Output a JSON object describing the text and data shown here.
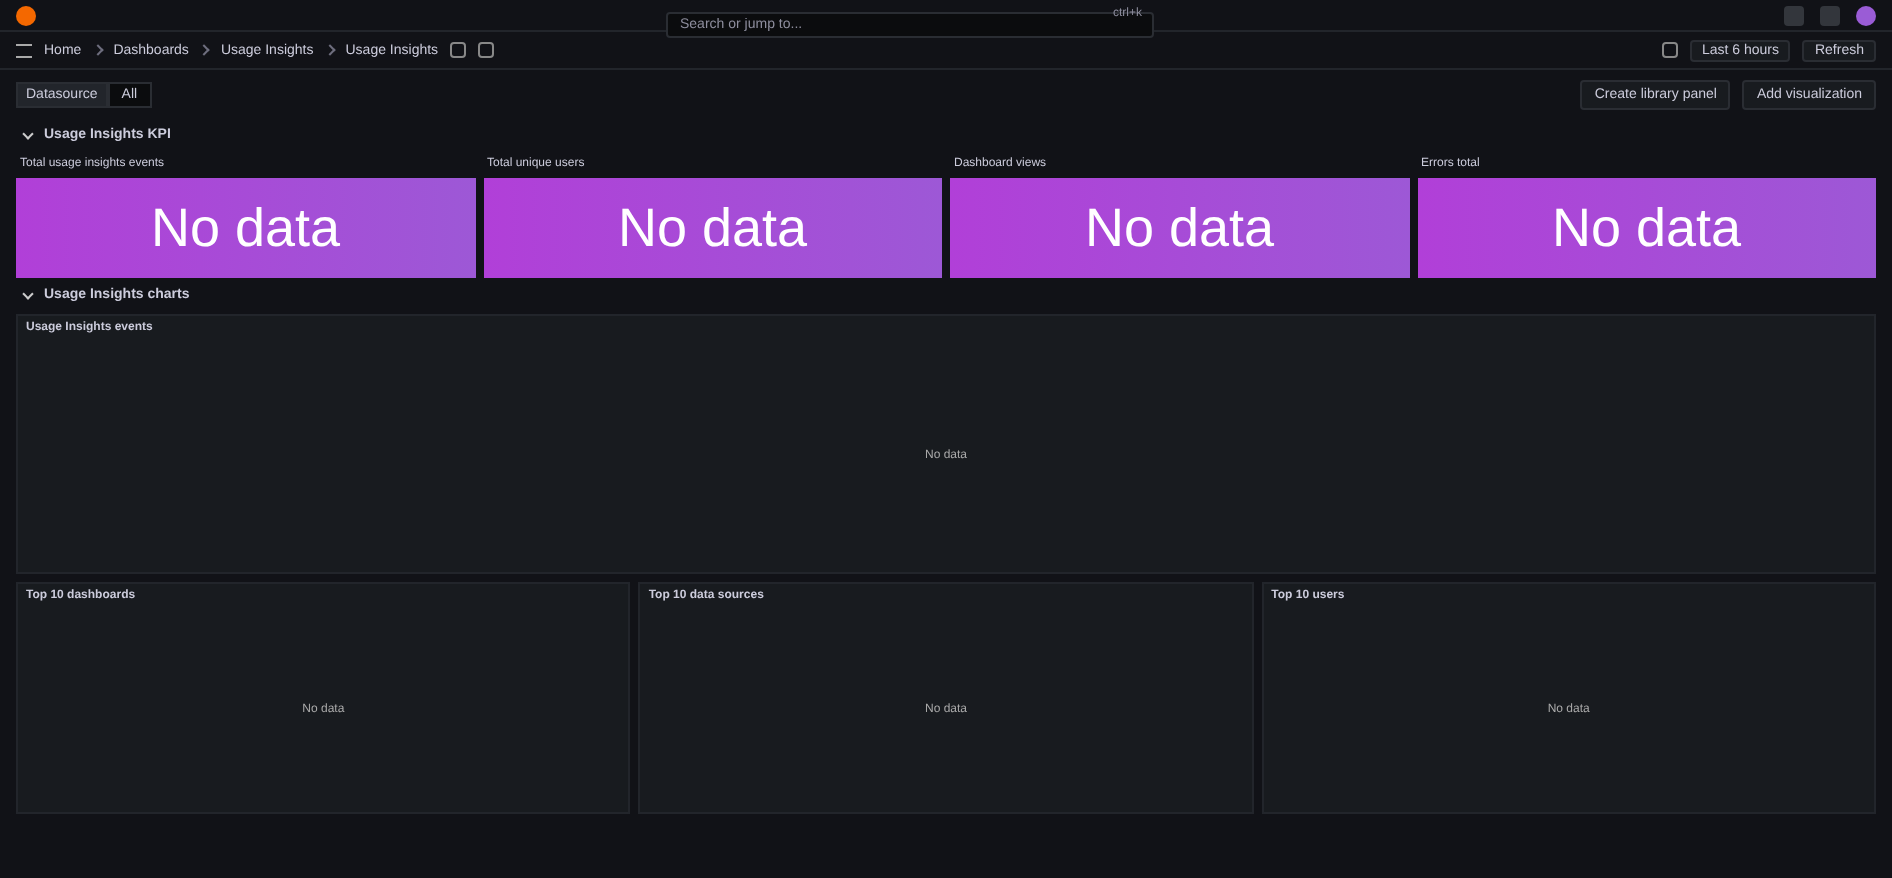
{
  "top_bar": {
    "search": {
      "placeholder": "Search or jump to..."
    },
    "shortcut": "ctrl+k"
  },
  "breadcrumbs": [
    {
      "label": "Home"
    },
    {
      "label": "Dashboards"
    },
    {
      "label": "Usage Insights"
    },
    {
      "label": "Usage Insights"
    }
  ],
  "toolbar": {
    "time_range": "Last 6 hours",
    "refresh": "Refresh"
  },
  "variables": [
    {
      "label": "Datasource",
      "value": "All"
    }
  ],
  "actions": [
    {
      "label": "Create library panel"
    },
    {
      "label": "Add visualization"
    }
  ],
  "rows": [
    {
      "title": "Usage Insights KPI",
      "expanded": true
    },
    {
      "title": "Usage Insights charts",
      "expanded": true
    }
  ],
  "stat_panels": [
    {
      "title": "Total usage insights events",
      "value": "No data"
    },
    {
      "title": "Total unique users",
      "value": "No data"
    },
    {
      "title": "Dashboard views",
      "value": "No data"
    },
    {
      "title": "Errors total",
      "value": "No data"
    }
  ],
  "main_panel": {
    "title": "Usage Insights events",
    "message": "No data"
  },
  "panels": [
    {
      "title": "Top 10 dashboards",
      "message": "No data"
    },
    {
      "title": "Top 10 data sources",
      "message": "No data"
    },
    {
      "title": "Top 10 users",
      "message": "No data"
    }
  ]
}
